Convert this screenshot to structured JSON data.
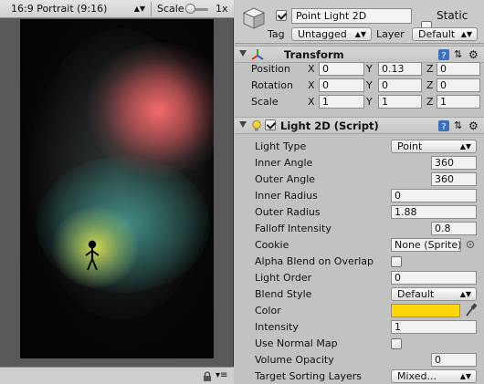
{
  "game_view": {
    "resolution": "16:9 Portrait (9:16)",
    "scale_label": "Scale",
    "scale_value": "1x"
  },
  "inspector": {
    "object_name": "Point Light 2D",
    "active": true,
    "static_label": "Static",
    "static": false,
    "tag_label": "Tag",
    "tag_value": "Untagged",
    "layer_label": "Layer",
    "layer_value": "Default"
  },
  "transform": {
    "title": "Transform",
    "rows": [
      {
        "label": "Position",
        "x": "0",
        "y": "0.13",
        "z": "0"
      },
      {
        "label": "Rotation",
        "x": "0",
        "y": "0",
        "z": "0"
      },
      {
        "label": "Scale",
        "x": "1",
        "y": "1",
        "z": "1"
      }
    ],
    "axis_labels": [
      "X",
      "Y",
      "Z"
    ]
  },
  "light2d": {
    "title": "Light 2D (Script)",
    "enabled": true,
    "color": "#ffd60a",
    "props": [
      {
        "label": "Light Type",
        "value": "Point"
      },
      {
        "label": "Inner Angle",
        "value": "360"
      },
      {
        "label": "Outer Angle",
        "value": "360"
      },
      {
        "label": "Inner Radius",
        "value": "0"
      },
      {
        "label": "Outer Radius",
        "value": "1.88"
      },
      {
        "label": "Falloff Intensity",
        "value": "0.8"
      },
      {
        "label": "Cookie",
        "value": "None (Sprite)"
      },
      {
        "label": "Alpha Blend on Overlap",
        "value": ""
      },
      {
        "label": "Light Order",
        "value": "0"
      },
      {
        "label": "Blend Style",
        "value": "Default"
      },
      {
        "label": "Color",
        "value": ""
      },
      {
        "label": "Intensity",
        "value": "1"
      },
      {
        "label": "Use Normal Map",
        "value": ""
      },
      {
        "label": "Volume Opacity",
        "value": "0"
      },
      {
        "label": "Target Sorting Layers",
        "value": "Mixed..."
      }
    ],
    "alpha_blend_checked": false,
    "use_normal_map_checked": false
  }
}
